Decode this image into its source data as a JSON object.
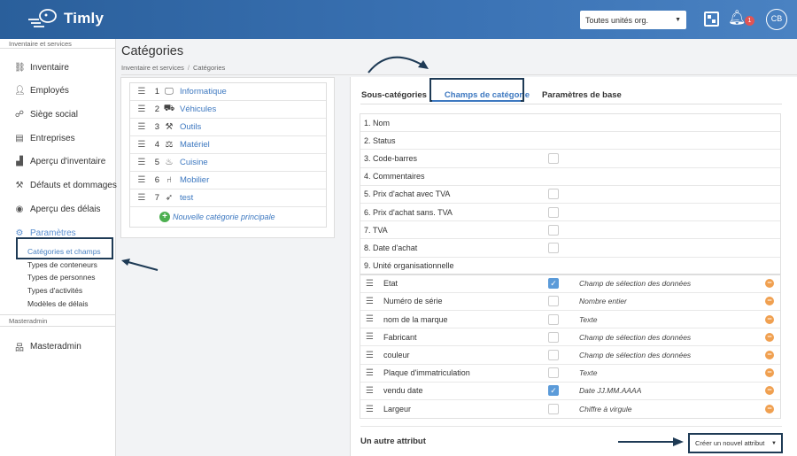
{
  "header": {
    "brand": "Timly",
    "org_select": "Toutes unités org.",
    "notification_count": "1",
    "avatar_initials": "CB"
  },
  "sidebar": {
    "section1": "Inventaire et services",
    "items": [
      {
        "label": "Inventaire",
        "icon": "tree-structure-icon"
      },
      {
        "label": "Employés",
        "icon": "person-icon"
      },
      {
        "label": "Siège social",
        "icon": "network-icon"
      },
      {
        "label": "Entreprises",
        "icon": "building-icon"
      },
      {
        "label": "Aperçu d'inventaire",
        "icon": "chart-icon"
      },
      {
        "label": "Défauts et dommages",
        "icon": "wrench-icon"
      },
      {
        "label": "Aperçu des délais",
        "icon": "eye-icon"
      },
      {
        "label": "Paramètres",
        "icon": "gear-icon"
      }
    ],
    "sub_items": [
      "Catégories et champs",
      "Types de conteneurs",
      "Types de personnes",
      "Types d'activités",
      "Modèles de délais"
    ],
    "section2": "Masteradmin",
    "master_item": "Masteradmin"
  },
  "page": {
    "title": "Catégories",
    "breadcrumb": [
      "Inventaire et services",
      "Catégories"
    ]
  },
  "categories": [
    {
      "num": "1",
      "name": "Informatique",
      "icon": "monitor-icon"
    },
    {
      "num": "2",
      "name": "Véhicules",
      "icon": "truck-icon"
    },
    {
      "num": "3",
      "name": "Outils",
      "icon": "tools-icon"
    },
    {
      "num": "4",
      "name": "Matériel",
      "icon": "scale-icon"
    },
    {
      "num": "5",
      "name": "Cuisine",
      "icon": "pot-icon"
    },
    {
      "num": "6",
      "name": "Mobilier",
      "icon": "chair-icon"
    },
    {
      "num": "7",
      "name": "test",
      "icon": "rocket-icon"
    }
  ],
  "new_category": "Nouvelle catégorie principale",
  "tabs": [
    "Sous-catégories",
    "Champs de catégorie",
    "Paramètres de base"
  ],
  "fixed_fields": [
    {
      "label": "1. Nom",
      "checkbox": false,
      "show_cb": false
    },
    {
      "label": "2. Status",
      "checkbox": false,
      "show_cb": false
    },
    {
      "label": "3. Code-barres",
      "checkbox": false,
      "show_cb": true
    },
    {
      "label": "4. Commentaires",
      "checkbox": false,
      "show_cb": false
    },
    {
      "label": "5. Prix d'achat avec TVA",
      "checkbox": false,
      "show_cb": true
    },
    {
      "label": "6. Prix d'achat sans. TVA",
      "checkbox": false,
      "show_cb": true
    },
    {
      "label": "7. TVA",
      "checkbox": false,
      "show_cb": true
    },
    {
      "label": "8. Date d'achat",
      "checkbox": false,
      "show_cb": true
    },
    {
      "label": "9. Unité organisationnelle",
      "checkbox": false,
      "show_cb": false
    }
  ],
  "attributes": [
    {
      "label": "Etat",
      "checked": true,
      "type": "Champ de sélection des données"
    },
    {
      "label": "Numéro de série",
      "checked": false,
      "type": "Nombre entier"
    },
    {
      "label": "nom de la marque",
      "checked": false,
      "type": "Texte"
    },
    {
      "label": "Fabricant",
      "checked": false,
      "type": "Champ de sélection des données"
    },
    {
      "label": "couleur",
      "checked": false,
      "type": "Champ de sélection des données"
    },
    {
      "label": "Plaque d'immatriculation",
      "checked": false,
      "type": "Texte"
    },
    {
      "label": "vendu date",
      "checked": true,
      "type": "Date JJ.MM.AAAA"
    },
    {
      "label": "Largeur",
      "checked": false,
      "type": "Chiffre à virgule"
    }
  ],
  "other_attribute_label": "Un autre attribut",
  "create_button": "Créer un nouvel attribut",
  "colors": {
    "header": "#3b73b5",
    "link": "#3d78c0",
    "highlight_box": "#1e3a55",
    "remove": "#f0a050",
    "add": "#4caf50"
  }
}
